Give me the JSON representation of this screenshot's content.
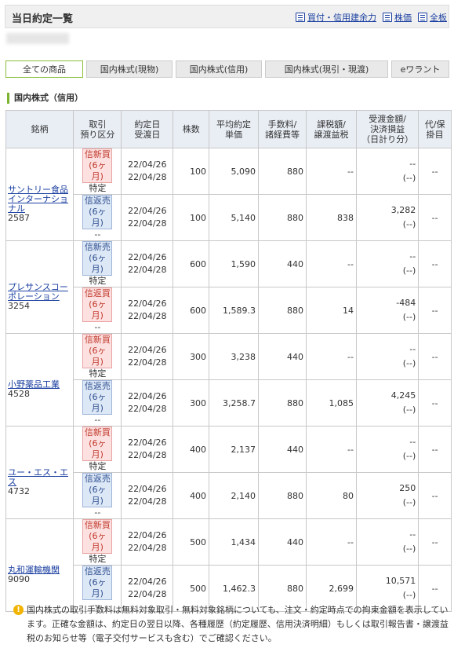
{
  "title": "当日約定一覧",
  "header_links": [
    {
      "label": "買付・信用建余力",
      "icon": "buying-power-icon"
    },
    {
      "label": "株価",
      "icon": "stock-price-icon"
    },
    {
      "label": "全板",
      "icon": "order-book-icon"
    }
  ],
  "tabs": [
    {
      "label": "全ての商品",
      "active": true
    },
    {
      "label": "国内株式(現物)",
      "active": false
    },
    {
      "label": "国内株式(信用)",
      "active": false
    },
    {
      "label": "国内株式(現引・現渡)",
      "active": false
    },
    {
      "label": "eワラント",
      "active": false
    }
  ],
  "section_title": "国内株式（信用）",
  "columns": [
    {
      "l1": "銘柄",
      "l2": "",
      "l3": ""
    },
    {
      "l1": "取引",
      "l2": "預り区分",
      "l3": ""
    },
    {
      "l1": "約定日",
      "l2": "受渡日",
      "l3": ""
    },
    {
      "l1": "株数",
      "l2": "",
      "l3": ""
    },
    {
      "l1": "平均約定",
      "l2": "単価",
      "l3": ""
    },
    {
      "l1": "手数料/",
      "l2": "諸経費等",
      "l3": ""
    },
    {
      "l1": "課税額/",
      "l2": "譲渡益税",
      "l3": ""
    },
    {
      "l1": "受渡金額/",
      "l2": "決済損益",
      "l3": "（日計り分）"
    },
    {
      "l1": "代/保",
      "l2": "掛目",
      "l3": ""
    }
  ],
  "stocks": [
    {
      "name": "サントリー食品インターナショナル",
      "code": "2587",
      "rows": [
        {
          "type": "信新買",
          "period": "(6ヶ月)",
          "account": "特定",
          "side": "buy",
          "trade_date": "22/04/26",
          "delivery_date": "22/04/28",
          "qty": "100",
          "price": "5,090",
          "fee": "880",
          "tax": "--",
          "amount": "--",
          "amount_sub": "(--)",
          "margin": "--"
        },
        {
          "type": "信返売",
          "period": "(6ヶ月)",
          "account": "--",
          "side": "sell",
          "trade_date": "22/04/26",
          "delivery_date": "22/04/28",
          "qty": "100",
          "price": "5,140",
          "fee": "880",
          "tax": "838",
          "amount": "3,282",
          "amount_sub": "(--)",
          "margin": "--"
        }
      ]
    },
    {
      "name": "プレサンスコーポレーション",
      "code": "3254",
      "rows": [
        {
          "type": "信新売",
          "period": "(6ヶ月)",
          "account": "特定",
          "side": "sell",
          "trade_date": "22/04/26",
          "delivery_date": "22/04/28",
          "qty": "600",
          "price": "1,590",
          "fee": "440",
          "tax": "--",
          "amount": "--",
          "amount_sub": "(--)",
          "margin": "--"
        },
        {
          "type": "信返買",
          "period": "(6ヶ月)",
          "account": "--",
          "side": "buy",
          "trade_date": "22/04/26",
          "delivery_date": "22/04/28",
          "qty": "600",
          "price": "1,589.3",
          "fee": "880",
          "tax": "14",
          "amount": "-484",
          "amount_sub": "(--)",
          "margin": "--"
        }
      ]
    },
    {
      "name": "小野薬品工業",
      "code": "4528",
      "rows": [
        {
          "type": "信新買",
          "period": "(6ヶ月)",
          "account": "特定",
          "side": "buy",
          "trade_date": "22/04/26",
          "delivery_date": "22/04/28",
          "qty": "300",
          "price": "3,238",
          "fee": "440",
          "tax": "--",
          "amount": "--",
          "amount_sub": "(--)",
          "margin": "--"
        },
        {
          "type": "信返売",
          "period": "(6ヶ月)",
          "account": "--",
          "side": "sell",
          "trade_date": "22/04/26",
          "delivery_date": "22/04/28",
          "qty": "300",
          "price": "3,258.7",
          "fee": "880",
          "tax": "1,085",
          "amount": "4,245",
          "amount_sub": "(--)",
          "margin": "--"
        }
      ]
    },
    {
      "name": "ユー・エス・エス",
      "code": "4732",
      "rows": [
        {
          "type": "信新買",
          "period": "(6ヶ月)",
          "account": "特定",
          "side": "buy",
          "trade_date": "22/04/26",
          "delivery_date": "22/04/28",
          "qty": "400",
          "price": "2,137",
          "fee": "440",
          "tax": "--",
          "amount": "--",
          "amount_sub": "(--)",
          "margin": "--"
        },
        {
          "type": "信返売",
          "period": "(6ヶ月)",
          "account": "--",
          "side": "sell",
          "trade_date": "22/04/26",
          "delivery_date": "22/04/28",
          "qty": "400",
          "price": "2,140",
          "fee": "880",
          "tax": "80",
          "amount": "250",
          "amount_sub": "(--)",
          "margin": "--"
        }
      ]
    },
    {
      "name": "丸和運輸機関",
      "code": "9090",
      "rows": [
        {
          "type": "信新買",
          "period": "(6ヶ月)",
          "account": "特定",
          "side": "buy",
          "trade_date": "22/04/26",
          "delivery_date": "22/04/28",
          "qty": "500",
          "price": "1,434",
          "fee": "440",
          "tax": "--",
          "amount": "--",
          "amount_sub": "(--)",
          "margin": "--"
        },
        {
          "type": "信返売",
          "period": "(6ヶ月)",
          "account": "--",
          "side": "sell",
          "trade_date": "22/04/26",
          "delivery_date": "22/04/28",
          "qty": "500",
          "price": "1,462.3",
          "fee": "880",
          "tax": "2,699",
          "amount": "10,571",
          "amount_sub": "(--)",
          "margin": "--"
        }
      ]
    }
  ],
  "notice": "国内株式の取引手数料は無料対象取引・無料対象銘柄についても、注文・約定時点での拘束金額を表示しています。正確な金額は、約定日の翌日以降、各種履歴（約定履歴、信用決済明細）もしくは取引報告書・譲渡益税のお知らせ等（電子交付サービスも含む）でご確認ください。",
  "colors": {
    "accent_green": "#7bb32e",
    "link_blue": "#1a3fa0",
    "buy_red": "#c0392b",
    "sell_blue": "#2f4f8f"
  }
}
